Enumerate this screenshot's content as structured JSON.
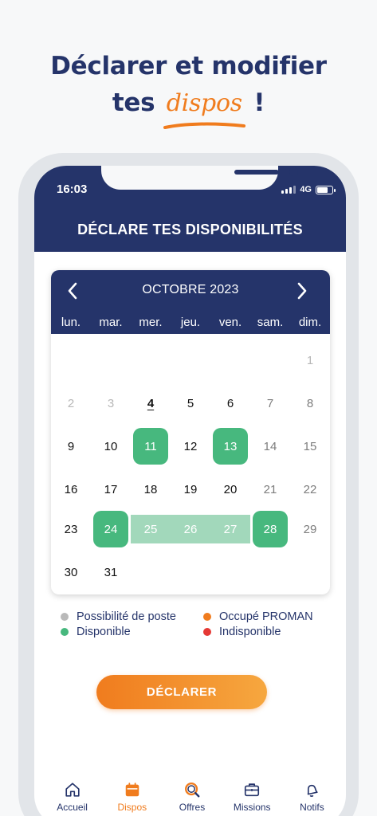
{
  "promo": {
    "line1": "Déclarer et modifier",
    "line2_before": "tes",
    "line2_script": "dispos",
    "line2_after": "!"
  },
  "status_bar": {
    "time": "16:03",
    "network": "4G"
  },
  "app_bar": {
    "title": "DÉCLARE TES DISPONIBILITÉS"
  },
  "calendar": {
    "month": "OCTOBRE 2023",
    "weekdays": [
      "lun.",
      "mar.",
      "mer.",
      "jeu.",
      "ven.",
      "sam.",
      "dim."
    ],
    "days": {
      "d1": "1",
      "d2": "2",
      "d3": "3",
      "d4": "4",
      "d5": "5",
      "d6": "6",
      "d7": "7",
      "d8": "8",
      "d9": "9",
      "d10": "10",
      "d11": "11",
      "d12": "12",
      "d13": "13",
      "d14": "14",
      "d15": "15",
      "d16": "16",
      "d17": "17",
      "d18": "18",
      "d19": "19",
      "d20": "20",
      "d21": "21",
      "d22": "22",
      "d23": "23",
      "d24": "24",
      "d25": "25",
      "d26": "26",
      "d27": "27",
      "d28": "28",
      "d29": "29",
      "d30": "30",
      "d31": "31"
    },
    "today": "4",
    "disponible_days": [
      "11",
      "13",
      "24",
      "28"
    ],
    "selected_range": [
      "25",
      "26",
      "27"
    ]
  },
  "legend": [
    {
      "label": "Possibilité de poste",
      "color": "#b9b9b9"
    },
    {
      "label": "Occupé PROMAN",
      "color": "#f07c1e"
    },
    {
      "label": "Disponible",
      "color": "#47b87e"
    },
    {
      "label": "Indisponible",
      "color": "#e53935"
    }
  ],
  "declare_button": {
    "label": "DÉCLARER"
  },
  "tab_bar": {
    "accueil": "Accueil",
    "dispos": "Dispos",
    "offres": "Offres",
    "missions": "Missions",
    "notifs": "Notifs",
    "active": "Dispos"
  },
  "colors": {
    "navy": "#25346a",
    "orange": "#f07c1e",
    "green": "#47b87e",
    "range_green": "#a2d8bb"
  }
}
